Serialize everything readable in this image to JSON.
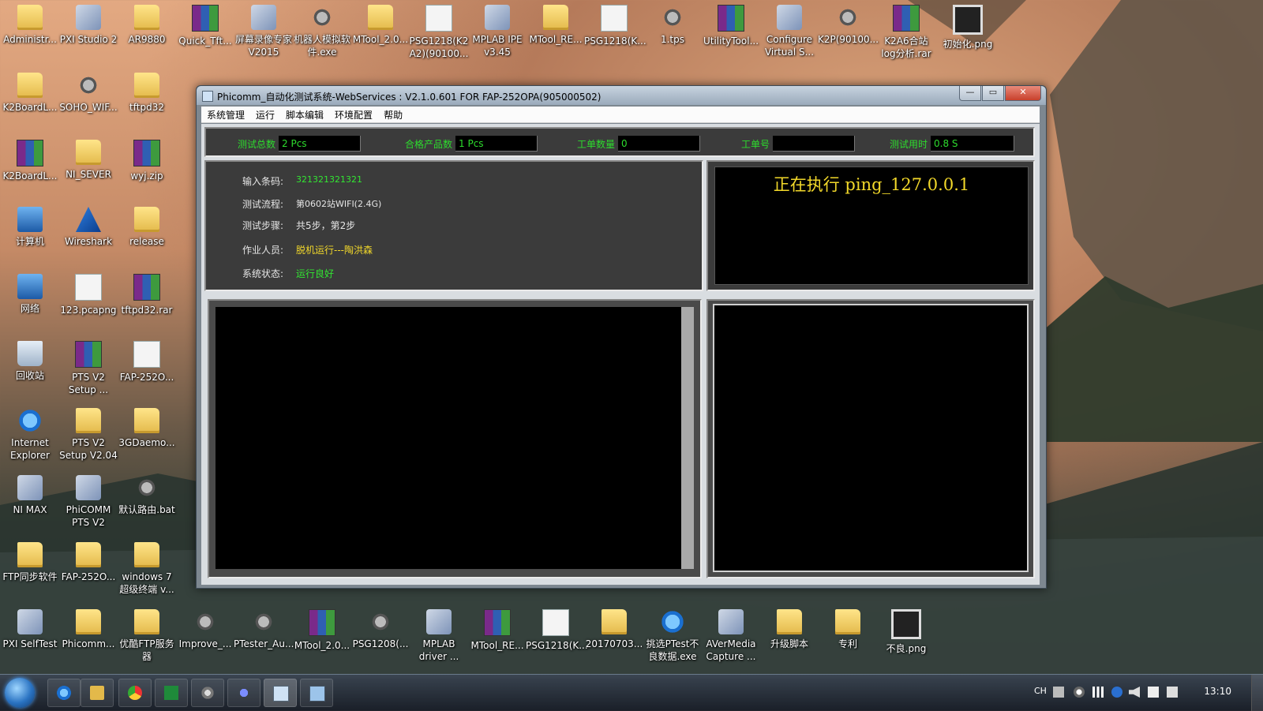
{
  "desktop_icons": [
    {
      "label": "Administr...",
      "type": "folder"
    },
    {
      "label": "PXI Studio 2",
      "type": "app"
    },
    {
      "label": "AR9880",
      "type": "folder"
    },
    {
      "label": "Quick_Tft...",
      "type": "rar"
    },
    {
      "label": "屏幕录像专家 V2015",
      "type": "app"
    },
    {
      "label": "机器人模拟软件.exe",
      "type": "tool"
    },
    {
      "label": "MTool_2.0...",
      "type": "folder"
    },
    {
      "label": "PSG1218(K2 A2)(90100...",
      "type": "doc"
    },
    {
      "label": "MPLAB IPE v3.45",
      "type": "app"
    },
    {
      "label": "MTool_RE...",
      "type": "folder"
    },
    {
      "label": "PSG1218(K...",
      "type": "doc"
    },
    {
      "label": "1.tps",
      "type": "tool"
    },
    {
      "label": "UtilityTool...",
      "type": "rar"
    },
    {
      "label": "Configure Virtual S...",
      "type": "app"
    },
    {
      "label": "K2P(90100...",
      "type": "tool"
    },
    {
      "label": "K2A6合站 log分析.rar",
      "type": "rar"
    },
    {
      "label": "初始化.png",
      "type": "img"
    },
    {
      "label": "K2BoardL...",
      "type": "folder"
    },
    {
      "label": "SOHO_WIF...",
      "type": "tool"
    },
    {
      "label": "tftpd32",
      "type": "folder"
    },
    {
      "label": "K2BoardL...",
      "type": "rar"
    },
    {
      "label": "NI_SEVER",
      "type": "folder"
    },
    {
      "label": "wyj.zip",
      "type": "rar"
    },
    {
      "label": "计算机",
      "type": "pc"
    },
    {
      "label": "Wireshark",
      "type": "shark"
    },
    {
      "label": "release",
      "type": "folder"
    },
    {
      "label": "网络",
      "type": "pc"
    },
    {
      "label": "123.pcapng",
      "type": "doc"
    },
    {
      "label": "tftpd32.rar",
      "type": "rar"
    },
    {
      "label": "回收站",
      "type": "bin"
    },
    {
      "label": "PTS V2 Setup ...",
      "type": "rar"
    },
    {
      "label": "FAP-252O...",
      "type": "doc"
    },
    {
      "label": "Internet Explorer",
      "type": "ie"
    },
    {
      "label": "PTS V2 Setup V2.04",
      "type": "folder"
    },
    {
      "label": "3GDaemo...",
      "type": "folder"
    },
    {
      "label": "NI MAX",
      "type": "app"
    },
    {
      "label": "PhiCOMM PTS V2",
      "type": "app"
    },
    {
      "label": "默认路由.bat",
      "type": "tool"
    },
    {
      "label": "FTP同步软件",
      "type": "folder"
    },
    {
      "label": "FAP-252O...",
      "type": "folder"
    },
    {
      "label": "windows 7 超级终端 v...",
      "type": "folder"
    },
    {
      "label": "PXI SelfTest",
      "type": "app"
    },
    {
      "label": "Phicomm...",
      "type": "folder"
    },
    {
      "label": "优酷FTP服务器",
      "type": "folder"
    },
    {
      "label": "Improve_...",
      "type": "tool"
    },
    {
      "label": "PTester_Au...",
      "type": "tool"
    },
    {
      "label": "MTool_2.0...",
      "type": "rar"
    },
    {
      "label": "PSG1208(...",
      "type": "tool"
    },
    {
      "label": "MPLAB driver ...",
      "type": "app"
    },
    {
      "label": "MTool_RE...",
      "type": "rar"
    },
    {
      "label": "PSG1218(K...",
      "type": "doc"
    },
    {
      "label": "20170703...",
      "type": "folder"
    },
    {
      "label": "挑选PTest不良数据.exe",
      "type": "ie"
    },
    {
      "label": "AVerMedia Capture ...",
      "type": "app"
    },
    {
      "label": "升级脚本",
      "type": "folder"
    },
    {
      "label": "专利",
      "type": "folder"
    },
    {
      "label": "不良.png",
      "type": "img"
    }
  ],
  "window": {
    "title": "Phicomm_自动化测试系统-WebServices : V2.1.0.601 FOR  FAP-252OPA(905000502)",
    "buttons": {
      "minimize": "—",
      "maximize": "▭",
      "close": "✕"
    }
  },
  "menu": [
    "系统管理",
    "运行",
    "脚本编辑",
    "环境配置",
    "帮助"
  ],
  "stats": {
    "total": {
      "label": "测试总数",
      "value": "2 Pcs"
    },
    "pass": {
      "label": "合格产品数",
      "value": "1 Pcs"
    },
    "order_qty": {
      "label": "工单数量",
      "value": "0"
    },
    "order_no": {
      "label": "工单号",
      "value": ""
    },
    "time": {
      "label": "测试用时",
      "value": "0.8 S"
    }
  },
  "info": {
    "barcode": {
      "label": "输入条码:",
      "value": "321321321321"
    },
    "flow": {
      "label": "测试流程:",
      "value": "第0602站WIFI(2.4G)"
    },
    "steps": {
      "label": "测试步骤:",
      "value": "共5步，第2步"
    },
    "operator": {
      "label": "作业人员:",
      "value": "脱机运行---陶洪森"
    },
    "status": {
      "label": "系统状态:",
      "value": "运行良好"
    }
  },
  "exec_status": "正在执行 ping_127.0.0.1",
  "taskbar": {
    "clock": "13:10",
    "lang": "CH"
  },
  "colors": {
    "label_green": "#2ddc2d",
    "value_yellow": "#f2d82a",
    "panel_bg": "#3b3b3b"
  }
}
